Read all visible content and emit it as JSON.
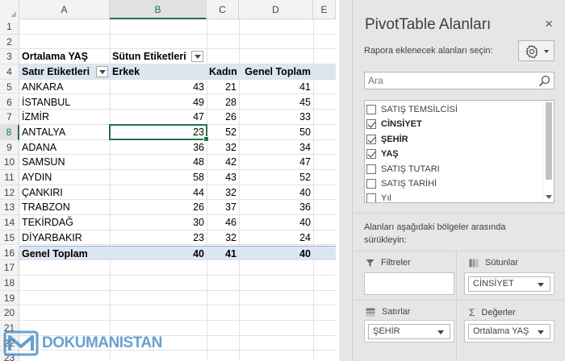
{
  "sheet": {
    "columns": [
      {
        "id": "A",
        "label": "A"
      },
      {
        "id": "B",
        "label": "B"
      },
      {
        "id": "C",
        "label": "C"
      },
      {
        "id": "D",
        "label": "D"
      },
      {
        "id": "E",
        "label": "E"
      }
    ],
    "row_numbers": [
      "1",
      "2",
      "3",
      "4",
      "5",
      "6",
      "7",
      "8",
      "9",
      "10",
      "11",
      "12",
      "13",
      "14",
      "15",
      "16",
      "17",
      "18",
      "19",
      "20",
      "21",
      "22",
      "23"
    ],
    "selected_column": "B",
    "selected_row": "8",
    "pivot": {
      "value_caption": "Ortalama YAŞ",
      "column_labels_caption": "Sütun Etiketleri",
      "row_labels_caption": "Satır Etiketleri",
      "col_headers": [
        "Erkek",
        "Kadın",
        "Genel Toplam"
      ],
      "rows": [
        {
          "label": "ANKARA",
          "values": [
            "43",
            "21",
            "41"
          ]
        },
        {
          "label": "İSTANBUL",
          "values": [
            "49",
            "28",
            "45"
          ]
        },
        {
          "label": "İZMİR",
          "values": [
            "47",
            "26",
            "33"
          ]
        },
        {
          "label": "ANTALYA",
          "values": [
            "23",
            "52",
            "50"
          ]
        },
        {
          "label": "ADANA",
          "values": [
            "36",
            "32",
            "34"
          ]
        },
        {
          "label": "SAMSUN",
          "values": [
            "48",
            "42",
            "47"
          ]
        },
        {
          "label": "AYDIN",
          "values": [
            "58",
            "43",
            "52"
          ]
        },
        {
          "label": "ÇANKIRI",
          "values": [
            "44",
            "32",
            "40"
          ]
        },
        {
          "label": "TRABZON",
          "values": [
            "26",
            "37",
            "36"
          ]
        },
        {
          "label": "TEKİRDAĞ",
          "values": [
            "30",
            "46",
            "40"
          ]
        },
        {
          "label": "DİYARBAKIR",
          "values": [
            "23",
            "32",
            "24"
          ]
        }
      ],
      "grand_total": {
        "label": "Genel Toplam",
        "values": [
          "40",
          "41",
          "40"
        ]
      }
    }
  },
  "watermark": {
    "text": "DOKUMANISTAN"
  },
  "pane": {
    "title": "PivotTable Alanları",
    "close_glyph": "×",
    "choose_label": "Rapora eklenecek alanları seçin:",
    "search_placeholder": "Ara",
    "fields": [
      {
        "name": "SATIŞ TEMSİLCİSİ",
        "checked": false
      },
      {
        "name": "CİNSİYET",
        "checked": true
      },
      {
        "name": "ŞEHİR",
        "checked": true
      },
      {
        "name": "YAŞ",
        "checked": true
      },
      {
        "name": "SATIŞ TUTARI",
        "checked": false
      },
      {
        "name": "SATIŞ TARİHİ",
        "checked": false
      },
      {
        "name": "Yıl",
        "checked": false
      }
    ],
    "drag_hint": "Alanları aşağıdaki bölgeler arasında sürükleyin:",
    "areas": {
      "filters": {
        "label": "Filtreler",
        "icon": "filter-icon",
        "chip": ""
      },
      "columns": {
        "label": "Sütunlar",
        "icon": "columns-icon",
        "chip": "CİNSİYET"
      },
      "rows": {
        "label": "Satırlar",
        "icon": "rows-icon",
        "chip": "ŞEHİR"
      },
      "values": {
        "label": "Değerler",
        "icon": "sigma-icon",
        "chip": "Ortalama YAŞ"
      }
    }
  },
  "colors": {
    "excel_green": "#217346",
    "pivot_header_fill": "#dce6f1",
    "pane_background": "#e6e6e6",
    "watermark_blue": "#4f8fc9"
  }
}
